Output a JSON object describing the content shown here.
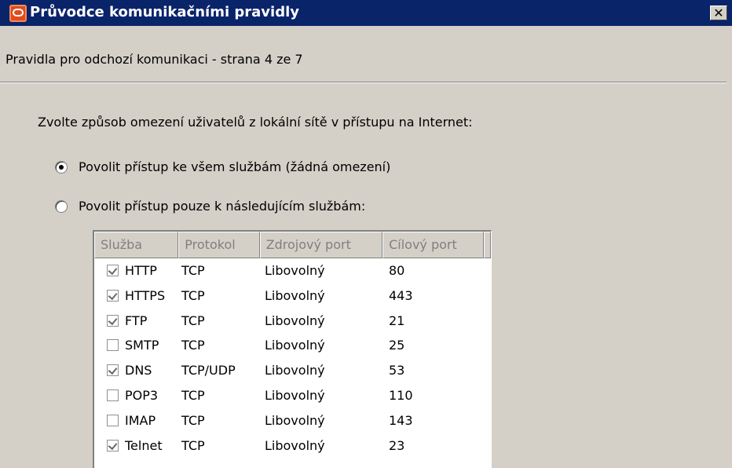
{
  "window": {
    "title": "Průvodce komunikačními pravidly",
    "close_label": "✕"
  },
  "page": {
    "subtitle": "Pravidla pro odchozí komunikaci - strana 4 ze 7",
    "prompt": "Zvolte způsob omezení uživatelů z lokální sítě v přístupu na Internet:"
  },
  "options": [
    {
      "label": "Povolit přístup ke všem službám (žádná omezení)",
      "selected": true
    },
    {
      "label": "Povolit přístup pouze k následujícím službám:",
      "selected": false
    }
  ],
  "services": {
    "columns": [
      "Služba",
      "Protokol",
      "Zdrojový port",
      "Cílový port"
    ],
    "rows": [
      {
        "service": "HTTP",
        "protocol": "TCP",
        "source_port": "Libovolný",
        "dest_port": "80",
        "checked": true
      },
      {
        "service": "HTTPS",
        "protocol": "TCP",
        "source_port": "Libovolný",
        "dest_port": "443",
        "checked": true
      },
      {
        "service": "FTP",
        "protocol": "TCP",
        "source_port": "Libovolný",
        "dest_port": "21",
        "checked": true
      },
      {
        "service": "SMTP",
        "protocol": "TCP",
        "source_port": "Libovolný",
        "dest_port": "25",
        "checked": false
      },
      {
        "service": "DNS",
        "protocol": "TCP/UDP",
        "source_port": "Libovolný",
        "dest_port": "53",
        "checked": true
      },
      {
        "service": "POP3",
        "protocol": "TCP",
        "source_port": "Libovolný",
        "dest_port": "110",
        "checked": false
      },
      {
        "service": "IMAP",
        "protocol": "TCP",
        "source_port": "Libovolný",
        "dest_port": "143",
        "checked": false
      },
      {
        "service": "Telnet",
        "protocol": "TCP",
        "source_port": "Libovolný",
        "dest_port": "23",
        "checked": true
      }
    ]
  }
}
